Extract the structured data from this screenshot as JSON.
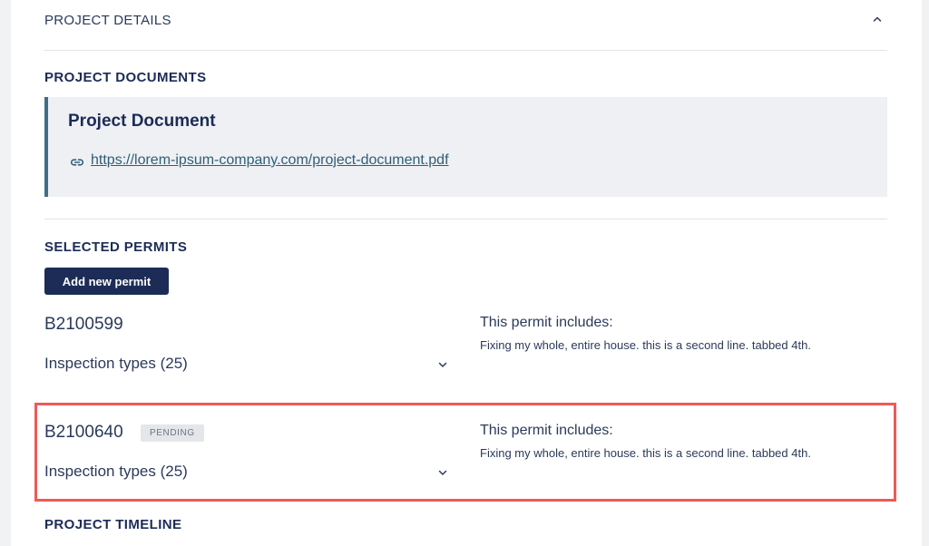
{
  "colors": {
    "primary": "#1c2c57",
    "accent_border": "#3d6f86",
    "link": "#2e5f78",
    "highlight": "#ef5a55",
    "badge_bg": "#e4e6ea"
  },
  "project_details": {
    "title": "PROJECT DETAILS",
    "collapse_icon": "chevron-up-icon"
  },
  "documents": {
    "heading": "PROJECT DOCUMENTS",
    "card_title": "Project Document",
    "link_icon": "link-icon",
    "link_text": "https://lorem-ipsum-company.com/project-document.pdf"
  },
  "permits": {
    "heading": "SELECTED PERMITS",
    "add_label": "Add new permit",
    "items": [
      {
        "id": "B2100599",
        "status": "",
        "inspection_label": "Inspection types (25)",
        "includes_title": "This permit includes:",
        "includes_desc": "Fixing my whole, entire house. this is a second line. tabbed 4th."
      },
      {
        "id": "B2100640",
        "status": "PENDING",
        "inspection_label": "Inspection types (25)",
        "includes_title": "This permit includes:",
        "includes_desc": "Fixing my whole, entire house. this is a second line. tabbed 4th."
      }
    ]
  },
  "timeline": {
    "heading": "PROJECT TIMELINE"
  }
}
